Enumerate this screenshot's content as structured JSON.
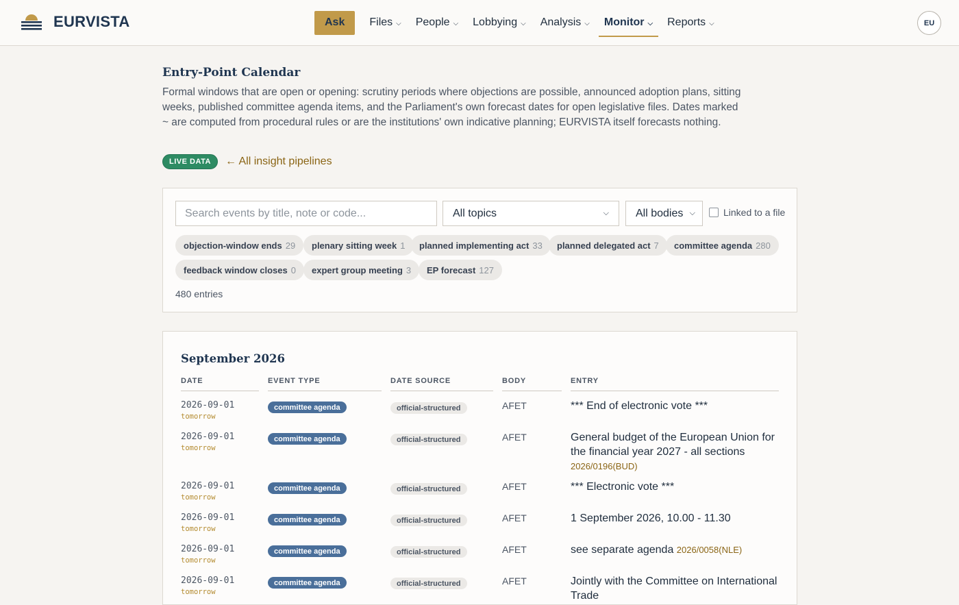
{
  "brand": {
    "name": "EURVISTA"
  },
  "nav": {
    "ask": "Ask",
    "items": [
      {
        "label": "Files"
      },
      {
        "label": "People"
      },
      {
        "label": "Lobbying"
      },
      {
        "label": "Analysis"
      },
      {
        "label": "Monitor",
        "active": true
      },
      {
        "label": "Reports"
      }
    ]
  },
  "user": {
    "initials": "EU"
  },
  "page": {
    "title": "Entry-Point Calendar",
    "description": "Formal windows that are open or opening: scrutiny periods where objections are possible, announced adoption plans, sitting weeks, published committee agenda items, and the Parliament's own forecast dates for open legislative files. Dates marked ~ are computed from procedural rules or are the institutions' own indicative planning; EURVISTA itself forecasts nothing.",
    "live_badge": "LIVE DATA",
    "back_link": "← All insight pipelines"
  },
  "filters": {
    "search_placeholder": "Search events by title, note or code...",
    "topics": "All topics",
    "bodies": "All bodies",
    "linked_label": "Linked to a file",
    "chips": [
      {
        "label": "objection-window ends",
        "count": "29"
      },
      {
        "label": "plenary sitting week",
        "count": "1"
      },
      {
        "label": "planned implementing act",
        "count": "33"
      },
      {
        "label": "planned delegated act",
        "count": "7"
      },
      {
        "label": "committee agenda",
        "count": "280"
      },
      {
        "label": "feedback window closes",
        "count": "0"
      },
      {
        "label": "expert group meeting",
        "count": "3"
      },
      {
        "label": "EP forecast",
        "count": "127"
      }
    ],
    "entries_count": "480 entries"
  },
  "calendar": {
    "month": "September 2026",
    "columns": {
      "date": "DATE",
      "type": "EVENT TYPE",
      "source": "DATE SOURCE",
      "body": "BODY",
      "entry": "ENTRY"
    },
    "rows": [
      {
        "date": "2026-09-01",
        "relative": "tomorrow",
        "type": "committee agenda",
        "source": "official-structured",
        "body": "AFET",
        "entry": "*** End of electronic vote ***",
        "code": ""
      },
      {
        "date": "2026-09-01",
        "relative": "tomorrow",
        "type": "committee agenda",
        "source": "official-structured",
        "body": "AFET",
        "entry": "General budget of the European Union for the financial year 2027 - all sections",
        "code": "2026/0196(BUD)"
      },
      {
        "date": "2026-09-01",
        "relative": "tomorrow",
        "type": "committee agenda",
        "source": "official-structured",
        "body": "AFET",
        "entry": "*** Electronic vote ***",
        "code": ""
      },
      {
        "date": "2026-09-01",
        "relative": "tomorrow",
        "type": "committee agenda",
        "source": "official-structured",
        "body": "AFET",
        "entry": "1 September 2026, 10.00 - 11.30",
        "code": ""
      },
      {
        "date": "2026-09-01",
        "relative": "tomorrow",
        "type": "committee agenda",
        "source": "official-structured",
        "body": "AFET",
        "entry": "see separate agenda",
        "code": "2026/0058(NLE)"
      },
      {
        "date": "2026-09-01",
        "relative": "tomorrow",
        "type": "committee agenda",
        "source": "official-structured",
        "body": "AFET",
        "entry": "Jointly with the Committee on International Trade",
        "code": ""
      }
    ]
  }
}
